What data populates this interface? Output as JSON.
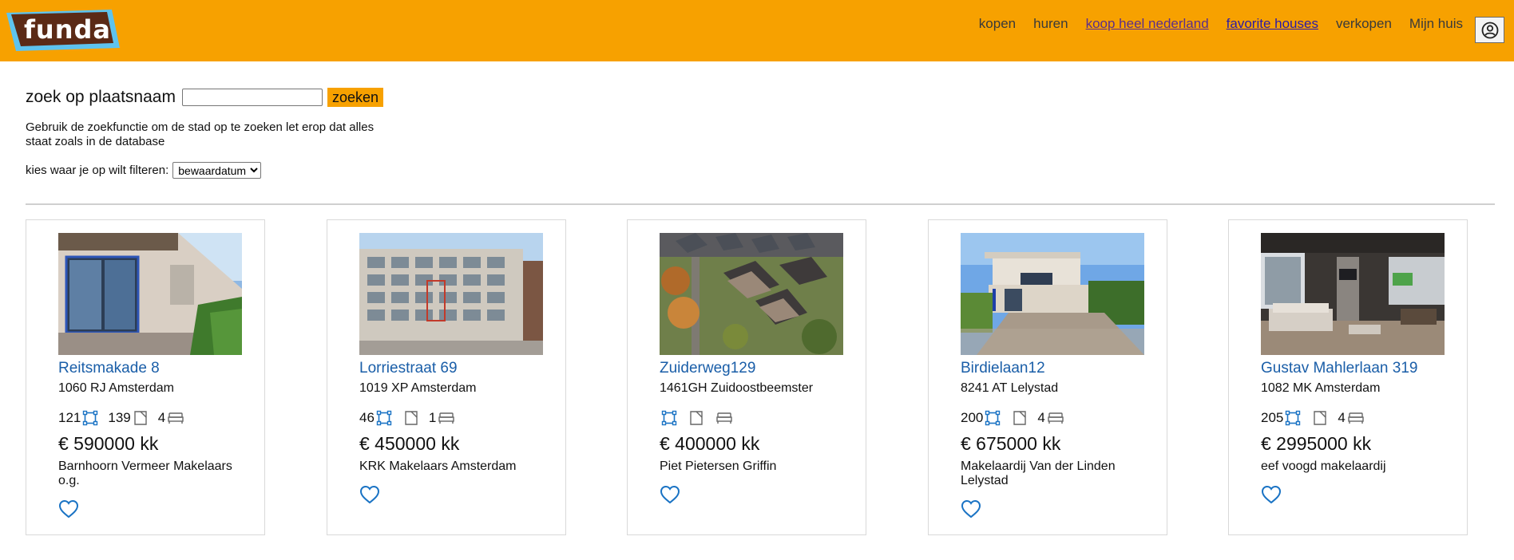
{
  "header": {
    "logo_text": "funda",
    "nav": [
      {
        "label": "kopen",
        "style": "plain"
      },
      {
        "label": "huren",
        "style": "plain"
      },
      {
        "label": "koop heel nederland",
        "style": "linked"
      },
      {
        "label": "favorite houses",
        "style": "visited-blue"
      },
      {
        "label": "verkopen",
        "style": "plain"
      },
      {
        "label": "Mijn huis",
        "style": "plain"
      }
    ],
    "account_icon": "user-circle-icon"
  },
  "search": {
    "label": "zoek op plaatsnaam",
    "value": "",
    "button_label": "zoeken",
    "help_text": "Gebruik de zoekfunctie om de stad op te zoeken let erop dat alles staat zoals in de database"
  },
  "filter": {
    "label": "kies waar je op wilt filteren:",
    "selected": "bewaardatum"
  },
  "colors": {
    "brand_orange": "#f7a100",
    "link_blue": "#1a5ea8",
    "logo_brown": "#5b2a16",
    "logo_blue": "#5ec3ee"
  },
  "listings": [
    {
      "street": "Reitsmakade 8",
      "postal": "1060 RJ Amsterdam",
      "living_area": "121",
      "plot_area": "139",
      "rooms": "4",
      "price": "€ 590000 kk",
      "agent": "Barnhoorn Vermeer Makelaars o.g.",
      "photo": "house-photo-bungalow"
    },
    {
      "street": "Lorriestraat 69",
      "postal": "1019 XP Amsterdam",
      "living_area": "46",
      "plot_area": "",
      "rooms": "1",
      "price": "€ 450000 kk",
      "agent": "KRK Makelaars Amsterdam",
      "photo": "house-photo-apartment-block"
    },
    {
      "street": "Zuiderweg129",
      "postal": "1461GH Zuidoostbeemster",
      "living_area": "",
      "plot_area": "",
      "rooms": "",
      "price": "€ 400000 kk",
      "agent": "Piet Pietersen Griffin",
      "photo": "house-photo-aerial"
    },
    {
      "street": "Birdielaan12",
      "postal": "8241 AT Lelystad",
      "living_area": "200",
      "plot_area": "",
      "rooms": "4",
      "price": "€ 675000 kk",
      "agent": "Makelaardij Van der Linden Lelystad",
      "photo": "house-photo-villa"
    },
    {
      "street": "Gustav Mahlerlaan 319",
      "postal": "1082 MK Amsterdam",
      "living_area": "205",
      "plot_area": "",
      "rooms": "4",
      "price": "€ 2995000 kk",
      "agent": "eef voogd makelaardij",
      "photo": "house-photo-interior"
    }
  ]
}
